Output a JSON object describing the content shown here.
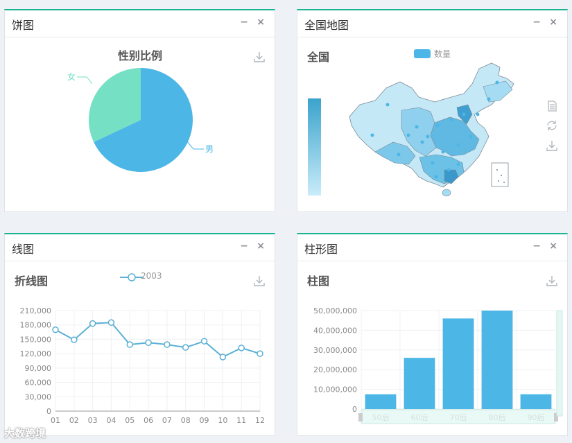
{
  "panels": {
    "pie": {
      "title": "饼图",
      "chart_title": "性别比例",
      "labels": [
        "女",
        "男"
      ]
    },
    "map": {
      "title": "全国地图",
      "chart_title": "全国",
      "legend": "数量"
    },
    "line": {
      "title": "线图",
      "chart_title": "折线图",
      "legend": "2003"
    },
    "bar": {
      "title": "柱形图",
      "chart_title": "柱图"
    }
  },
  "controls": {
    "minimize": "−",
    "close": "×"
  },
  "watermark": "大数跨境",
  "colors": {
    "accent": "#1ab394",
    "blue": "#4cb6e6",
    "green": "#76e0c4",
    "line": "#5bb0d5"
  },
  "chart_data": [
    {
      "type": "pie",
      "title": "性别比例",
      "categories": [
        "男",
        "女"
      ],
      "values": [
        68,
        32
      ]
    },
    {
      "type": "line",
      "title": "折线图",
      "categories": [
        "01",
        "02",
        "03",
        "04",
        "05",
        "06",
        "07",
        "08",
        "09",
        "10",
        "11",
        "12"
      ],
      "series": [
        {
          "name": "2003",
          "values": [
            170000,
            149000,
            183000,
            185000,
            139000,
            143000,
            139000,
            133000,
            146000,
            113000,
            132000,
            120000
          ]
        }
      ],
      "yticks": [
        "0",
        "30,000",
        "60,000",
        "90,000",
        "120,000",
        "150,000",
        "180,000",
        "210,000"
      ],
      "ylim": [
        0,
        210000
      ]
    },
    {
      "type": "bar",
      "title": "柱图",
      "categories": [
        "50后",
        "60后",
        "70后",
        "80后",
        "90后"
      ],
      "values": [
        7500000,
        26000000,
        46000000,
        50000000,
        7500000
      ],
      "yticks": [
        "0",
        "10,000,000",
        "20,000,000",
        "30,000,000",
        "40,000,000",
        "50,000,000"
      ],
      "ylim": [
        0,
        50000000
      ]
    }
  ]
}
